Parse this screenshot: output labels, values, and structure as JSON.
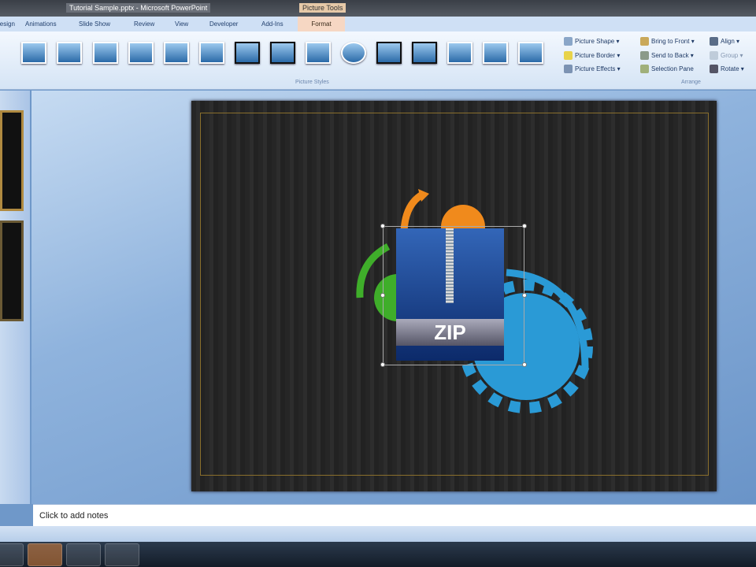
{
  "window": {
    "title": "Tutorial Sample.pptx - Microsoft PowerPoint",
    "context_tab": "Picture Tools"
  },
  "tabs": [
    {
      "label": "Design"
    },
    {
      "label": "Animations"
    },
    {
      "label": "Slide Show"
    },
    {
      "label": "Review"
    },
    {
      "label": "View"
    },
    {
      "label": "Developer"
    },
    {
      "label": "Add-Ins"
    }
  ],
  "active_tab": "Format",
  "ribbon": {
    "picture_styles_label": "Picture Styles",
    "picture_shape": "Picture Shape ▾",
    "picture_border": "Picture Border ▾",
    "picture_effects": "Picture Effects ▾",
    "bring_to_front": "Bring to Front ▾",
    "send_to_back": "Send to Back ▾",
    "selection_pane": "Selection Pane",
    "align": "Align ▾",
    "group": "Group ▾",
    "rotate": "Rotate ▾",
    "arrange_label": "Arrange"
  },
  "slide": {
    "zip_label": "ZIP"
  },
  "notes": {
    "placeholder": "Click to add notes"
  },
  "colors": {
    "orange": "#f08a1c",
    "green": "#3fae2a",
    "blue": "#2a9ad6",
    "border_gold": "#8a6f2c"
  }
}
